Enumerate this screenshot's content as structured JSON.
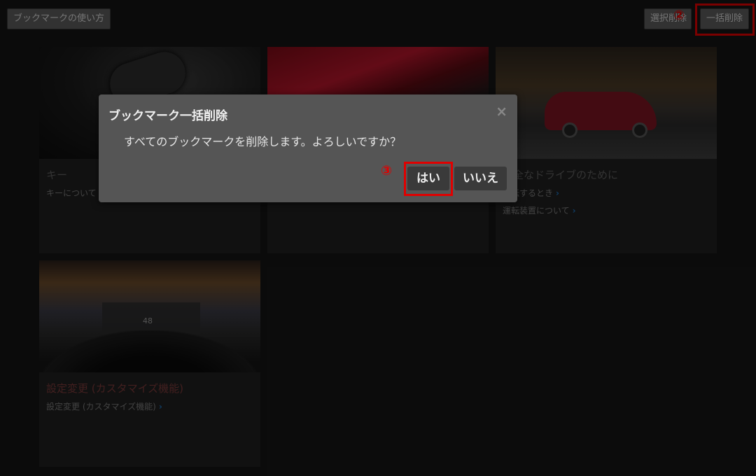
{
  "toolbar": {
    "help_label": "ブックマークの使い方",
    "select_delete_label": "選択削除",
    "delete_all_label": "一括削除"
  },
  "markers": {
    "step2": "②",
    "step3": "③"
  },
  "cards": [
    {
      "title": "キー",
      "links": [
        "キーについて"
      ]
    },
    {
      "title": "",
      "links": []
    },
    {
      "title": "安全なドライブのために",
      "links": [
        "運転するとき",
        "運転装置について"
      ]
    },
    {
      "title": "設定変更 (カスタマイズ機能)",
      "links": [
        "設定変更 (カスタマイズ機能)"
      ]
    }
  ],
  "hud_speed": "48",
  "dialog": {
    "title": "ブックマーク一括削除",
    "message": "すべてのブックマークを削除します。よろしいですか？",
    "yes_label": "はい",
    "no_label": "いいえ",
    "close_symbol": "×"
  },
  "colors": {
    "highlight": "#e00000",
    "link_chevron": "#1e6fb8",
    "dialog_bg": "#555555"
  }
}
